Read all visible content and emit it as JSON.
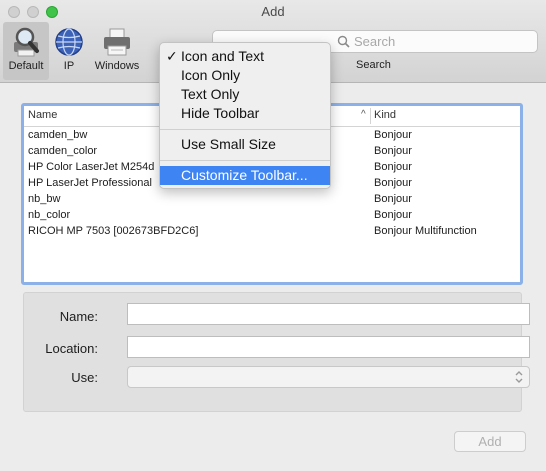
{
  "window": {
    "title": "Add",
    "accent_color": "#3f84f3"
  },
  "toolbar": {
    "items": [
      {
        "label": "Default",
        "icon": "default-printer-magnifier-icon",
        "selected": true
      },
      {
        "label": "IP",
        "icon": "globe-icon",
        "selected": false
      },
      {
        "label": "Windows",
        "icon": "windows-printer-icon",
        "selected": false
      }
    ],
    "search": {
      "placeholder": "Search",
      "label": "Search"
    }
  },
  "context_menu": {
    "items": [
      {
        "label": "Icon and Text",
        "checked": true
      },
      {
        "label": "Icon Only",
        "checked": false
      },
      {
        "label": "Text Only",
        "checked": false
      },
      {
        "label": "Hide Toolbar",
        "checked": false
      },
      {
        "label": "Use Small Size",
        "checked": false
      },
      {
        "label": "Customize Toolbar...",
        "highlighted": true
      }
    ]
  },
  "printer_table": {
    "columns": {
      "name": "Name",
      "kind": "Kind"
    },
    "rows": [
      {
        "name": "camden_bw",
        "kind": "Bonjour"
      },
      {
        "name": "camden_color",
        "kind": "Bonjour"
      },
      {
        "name": "HP Color LaserJet M254d",
        "kind": "Bonjour"
      },
      {
        "name": "HP LaserJet Professional",
        "kind": "Bonjour"
      },
      {
        "name": "nb_bw",
        "kind": "Bonjour"
      },
      {
        "name": "nb_color",
        "kind": "Bonjour"
      },
      {
        "name": "RICOH MP 7503 [002673BFD2C6]",
        "kind": "Bonjour Multifunction"
      }
    ]
  },
  "form": {
    "name_label": "Name:",
    "name_value": "",
    "location_label": "Location:",
    "location_value": "",
    "use_label": "Use:",
    "use_value": ""
  },
  "buttons": {
    "add": "Add"
  }
}
